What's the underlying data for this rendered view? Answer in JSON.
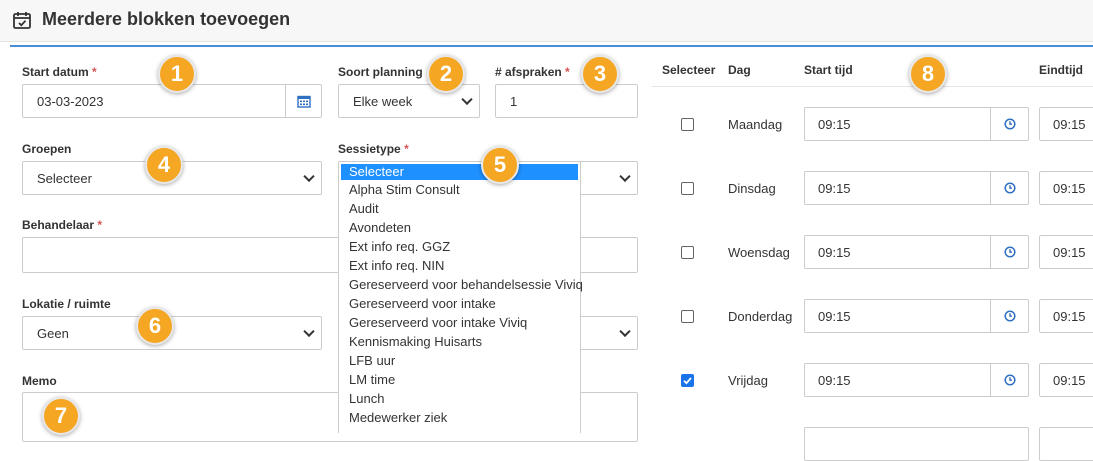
{
  "header": {
    "title": "Meerdere blokken toevoegen",
    "icon": "calendar-check-icon"
  },
  "form": {
    "start_datum": {
      "label": "Start datum",
      "required": "*",
      "value": "03-03-2023"
    },
    "soort_planning": {
      "label": "Soort planning",
      "value": "Elke week"
    },
    "afspraken": {
      "label": "# afspraken",
      "required": "*",
      "value": "1"
    },
    "groepen": {
      "label": "Groepen",
      "value": "Selecteer"
    },
    "sessietype": {
      "label": "Sessietype",
      "required": "*"
    },
    "behandelaar": {
      "label": "Behandelaar",
      "required": "*",
      "value": ""
    },
    "lokatie": {
      "label": "Lokatie / ruimte",
      "value": "Geen"
    },
    "memo": {
      "label": "Memo",
      "value": ""
    }
  },
  "sessietype_options": [
    "Selecteer",
    "Alpha Stim Consult",
    "Audit",
    "Avondeten",
    "Ext info req. GGZ",
    "Ext info req. NIN",
    "Gereserveerd voor behandelsessie Viviq",
    "Gereserveerd voor intake",
    "Gereserveerd voor intake Viviq",
    "Kennismaking Huisarts",
    "LFB uur",
    "LM time",
    "Lunch",
    "Medewerker ziek"
  ],
  "table": {
    "headers": {
      "select": "Selecteer",
      "day": "Dag",
      "start": "Start tijd",
      "end": "Eindtijd"
    },
    "rows": [
      {
        "day": "Maandag",
        "start": "09:15",
        "end": "09:15",
        "checked": false
      },
      {
        "day": "Dinsdag",
        "start": "09:15",
        "end": "09:15",
        "checked": false
      },
      {
        "day": "Woensdag",
        "start": "09:15",
        "end": "09:15",
        "checked": false
      },
      {
        "day": "Donderdag",
        "start": "09:15",
        "end": "09:15",
        "checked": false
      },
      {
        "day": "Vrijdag",
        "start": "09:15",
        "end": "09:15",
        "checked": true
      }
    ]
  },
  "badges": [
    "1",
    "2",
    "3",
    "4",
    "5",
    "6",
    "7",
    "8"
  ],
  "colors": {
    "accent": "#4a8bd8",
    "badge": "#f5a623",
    "required": "#d9534f",
    "selected_option": "#1e90ff"
  }
}
